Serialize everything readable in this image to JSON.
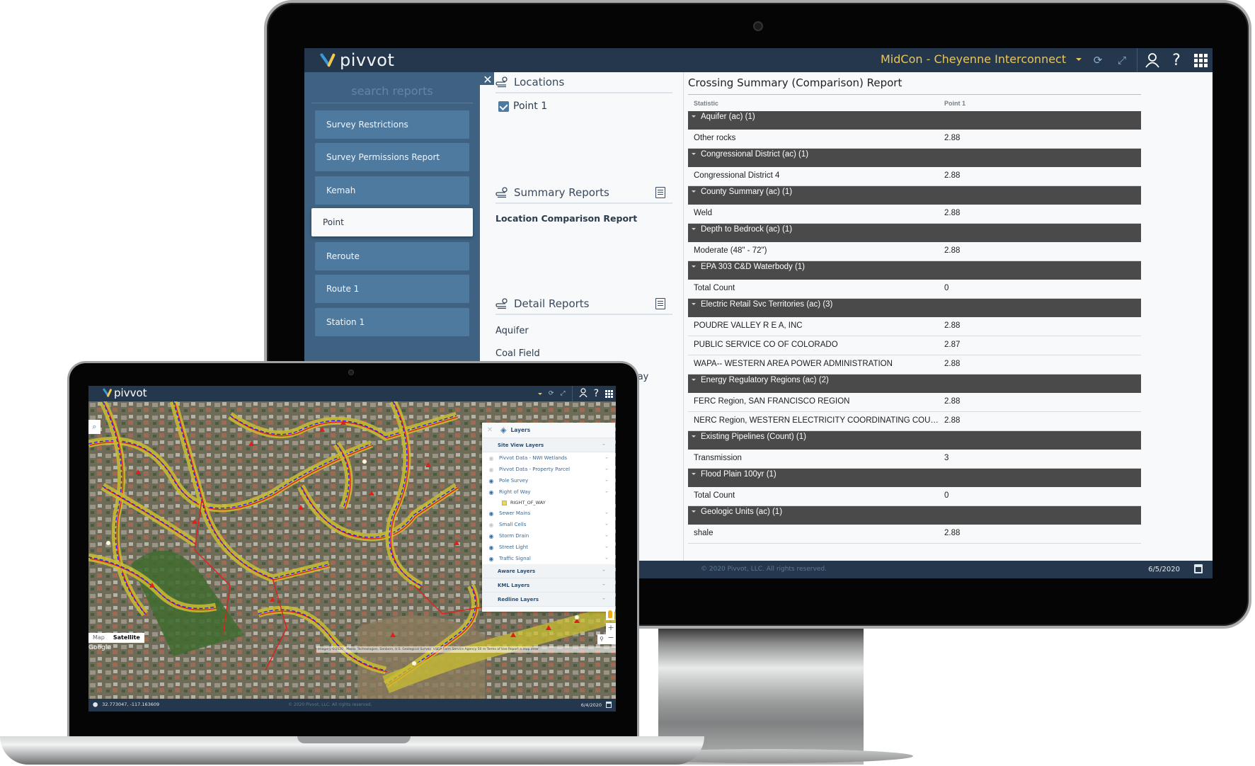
{
  "monitor": {
    "app": {
      "logo_text": "pivvot",
      "project_name": "MidCon - Cheyenne Interconnect",
      "header_icons": [
        "refresh-icon",
        "fullscreen-icon",
        "user-icon",
        "help-icon",
        "apps-grid-icon"
      ],
      "help_glyph": "?"
    },
    "sidebar": {
      "search_placeholder": "search reports",
      "items": [
        {
          "label": "Survey Restrictions",
          "active": false
        },
        {
          "label": "Survey Permissions Report",
          "active": false
        },
        {
          "label": "Kemah",
          "active": false
        },
        {
          "label": "Point",
          "active": true
        },
        {
          "label": "Reroute",
          "active": false
        },
        {
          "label": "Route 1",
          "active": false
        },
        {
          "label": "Station 1",
          "active": false
        }
      ],
      "close_glyph": "✕"
    },
    "middle": {
      "locations": {
        "title": "Locations",
        "items": [
          {
            "label": "Point 1",
            "checked": true
          }
        ]
      },
      "summary_reports": {
        "title": "Summary Reports",
        "items": [
          "Location Comparison Report"
        ]
      },
      "detail_reports": {
        "title": "Detail Reports",
        "items": [
          "Aquifer",
          "Coal Field"
        ],
        "partial_visible_text": "vay"
      }
    },
    "report": {
      "title": "Crossing Summary (Comparison) Report",
      "columns": [
        "Statistic",
        "Point 1"
      ],
      "groups": [
        {
          "name": "Aquifer (ac) (1)",
          "rows": [
            [
              "Other rocks",
              "2.88"
            ]
          ]
        },
        {
          "name": "Congressional District (ac) (1)",
          "rows": [
            [
              "Congressional District 4",
              "2.88"
            ]
          ]
        },
        {
          "name": "County Summary (ac) (1)",
          "rows": [
            [
              "Weld",
              "2.88"
            ]
          ]
        },
        {
          "name": "Depth to Bedrock (ac) (1)",
          "rows": [
            [
              "Moderate (48\" - 72\")",
              "2.88"
            ]
          ]
        },
        {
          "name": "EPA 303 C&D Waterbody (1)",
          "rows": [
            [
              "Total Count",
              "0"
            ]
          ]
        },
        {
          "name": "Electric Retail Svc Territories (ac) (3)",
          "rows": [
            [
              "POUDRE VALLEY R E A, INC",
              "2.88"
            ],
            [
              "PUBLIC SERVICE CO OF COLORADO",
              "2.87"
            ],
            [
              "WAPA-- WESTERN AREA POWER ADMINISTRATION",
              "2.88"
            ]
          ]
        },
        {
          "name": "Energy Regulatory Regions (ac) (2)",
          "rows": [
            [
              "FERC Region, SAN FRANCISCO REGION",
              "2.88"
            ],
            [
              "NERC Region, WESTERN ELECTRICITY COORDINATING COUN...",
              "2.88"
            ]
          ]
        },
        {
          "name": "Existing Pipelines (Count) (1)",
          "rows": [
            [
              "Transmission",
              "3"
            ]
          ]
        },
        {
          "name": "Flood Plain 100yr (1)",
          "rows": [
            [
              "Total Count",
              "0"
            ]
          ]
        },
        {
          "name": "Geologic Units (ac) (1)",
          "rows": [
            [
              "shale",
              "2.88"
            ]
          ]
        }
      ]
    },
    "footer": {
      "copyright": "© 2020 Pivvot, LLC. All rights reserved.",
      "date": "6/5/2020"
    }
  },
  "laptop": {
    "app": {
      "logo_text": "pivvot",
      "help_glyph": "?"
    },
    "layers_panel": {
      "title": "Layers",
      "close_glyph": "✕",
      "groups": [
        {
          "name": "Site View Layers",
          "items": [
            {
              "label": "Pivvot Data - NWI Wetlands",
              "visible": false
            },
            {
              "label": "Pivvot Data - Property Parcel",
              "visible": false
            },
            {
              "label": "Pole Survey",
              "visible": true
            },
            {
              "label": "Right of Way",
              "visible": true,
              "legend": "RIGHT_OF_WAY"
            },
            {
              "label": "Sewer Mains",
              "visible": true
            },
            {
              "label": "Small Cells",
              "visible": false
            },
            {
              "label": "Storm Drain",
              "visible": true
            },
            {
              "label": "Street Light",
              "visible": true
            },
            {
              "label": "Traffic Signal",
              "visible": true
            }
          ]
        },
        {
          "name": "Aware Layers"
        },
        {
          "name": "KML Layers"
        },
        {
          "name": "Redline Layers"
        }
      ]
    },
    "map": {
      "map_types": [
        "Map",
        "Satellite"
      ],
      "selected_map_type": "Satellite",
      "google_label": "Google",
      "attribution": "Imagery ©2020 , Maxar Technologies, Sanborn, U.S. Geological Survey, USDA Farm Service Agency   50 m   Terms of Use   Report a map error",
      "zoom_in": "+",
      "zoom_out": "−"
    },
    "footer": {
      "coordinates": "32.773047, -117.163609",
      "copyright": "© 2020 Pivvot, LLC. All rights reserved.",
      "date": "6/4/2020"
    }
  },
  "colors": {
    "header_bg": "#24374c",
    "sidebar_bg": "#3f6282",
    "sidebar_item_bg": "#4f7aa0",
    "project_name": "#e8c75a",
    "group_row_bg": "#4a4a4a",
    "logo_blue": "#3a9ad9",
    "logo_yellow": "#f2c94c"
  }
}
